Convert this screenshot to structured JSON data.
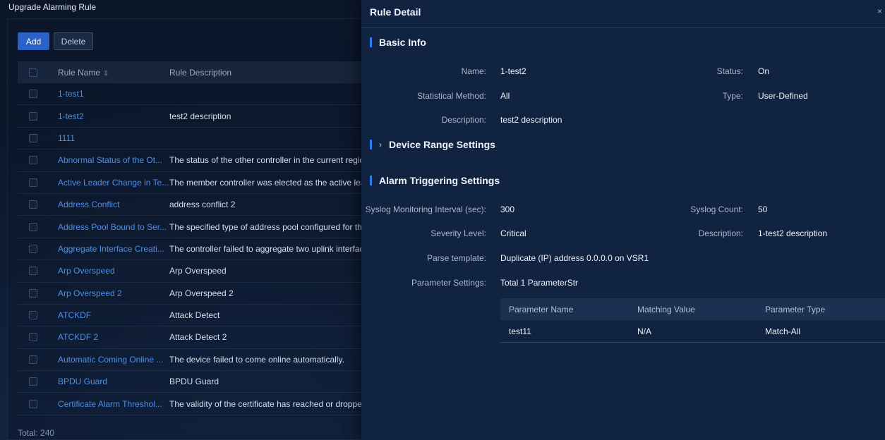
{
  "page": {
    "title": "Upgrade Alarming Rule",
    "add_label": "Add",
    "delete_label": "Delete",
    "total": "Total: 240"
  },
  "table": {
    "headers": {
      "name": "Rule Name",
      "description": "Rule Description"
    },
    "rows": [
      {
        "name": "1-test1",
        "description": ""
      },
      {
        "name": "1-test2",
        "description": "test2 description"
      },
      {
        "name": "1111",
        "description": ""
      },
      {
        "name": "Abnormal Status of the Ot...",
        "description": "The status of the other controller in the current region"
      },
      {
        "name": "Active Leader Change in Te...",
        "description": "The member controller was elected as the active leade"
      },
      {
        "name": "Address Conflict",
        "description": "address conflict 2"
      },
      {
        "name": "Address Pool Bound to Ser...",
        "description": "The specified type of address pool configured for the"
      },
      {
        "name": "Aggregate Interface Creati...",
        "description": "The controller failed to aggregate two uplink interface"
      },
      {
        "name": "Arp Overspeed",
        "description": "Arp Overspeed"
      },
      {
        "name": "Arp Overspeed 2",
        "description": "Arp Overspeed 2"
      },
      {
        "name": "ATCKDF",
        "description": "Attack Detect"
      },
      {
        "name": "ATCKDF 2",
        "description": "Attack Detect 2"
      },
      {
        "name": "Automatic Coming Online ...",
        "description": "The device failed to come online automatically."
      },
      {
        "name": "BPDU Guard",
        "description": "BPDU Guard"
      },
      {
        "name": "Certificate Alarm Threshol...",
        "description": "The validity of the certificate has reached or dropped t"
      }
    ]
  },
  "drawer": {
    "title": "Rule Detail",
    "close": "×",
    "basic_info": {
      "title": "Basic Info",
      "name_label": "Name:",
      "name_value": "1-test2",
      "status_label": "Status:",
      "status_value": "On",
      "method_label": "Statistical Method:",
      "method_value": "All",
      "type_label": "Type:",
      "type_value": "User-Defined",
      "desc_label": "Description:",
      "desc_value": "test2 description"
    },
    "device_range": {
      "title": "Device Range Settings"
    },
    "alarm_trigger": {
      "title": "Alarm Triggering Settings",
      "interval_label": "Syslog Monitoring Interval (sec):",
      "interval_value": "300",
      "count_label": "Syslog Count:",
      "count_value": "50",
      "severity_label": "Severity Level:",
      "severity_value": "Critical",
      "desc_label": "Description:",
      "desc_value": "1-test2 description",
      "template_label": "Parse template:",
      "template_value": "Duplicate (IP) address 0.0.0.0 on VSR1",
      "params_label": "Parameter Settings:",
      "params_value": "Total 1 ParameterStr",
      "param_headers": [
        "Parameter Name",
        "Matching Value",
        "Parameter Type"
      ],
      "param_rows": [
        [
          "test11",
          "N/A",
          "Match-All"
        ]
      ]
    }
  }
}
